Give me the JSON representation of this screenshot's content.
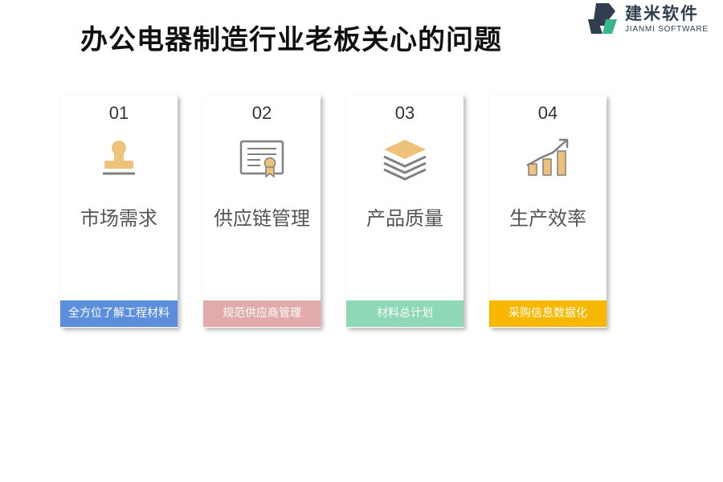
{
  "title": "办公电器制造行业老板关心的问题",
  "logo": {
    "name": "建米软件",
    "sub": "JIANMI SOFTWARE"
  },
  "cards": [
    {
      "num": "01",
      "title": "市场需求",
      "bar": "全方位了解工程材料",
      "bar_color": "#5b8fdc",
      "icon": "stamp-icon"
    },
    {
      "num": "02",
      "title": "供应链管理",
      "bar": "规范供应商管理",
      "bar_color": "#e2aaaa",
      "icon": "certificate-icon"
    },
    {
      "num": "03",
      "title": "产品质量",
      "bar": "材料总计划",
      "bar_color": "#8ed8b5",
      "icon": "layers-icon"
    },
    {
      "num": "04",
      "title": "生产效率",
      "bar": "采购信息数据化",
      "bar_color": "#f8b800",
      "icon": "growth-chart-icon"
    }
  ],
  "colors": {
    "icon_accent": "#eec27a",
    "icon_stroke": "#808080"
  }
}
